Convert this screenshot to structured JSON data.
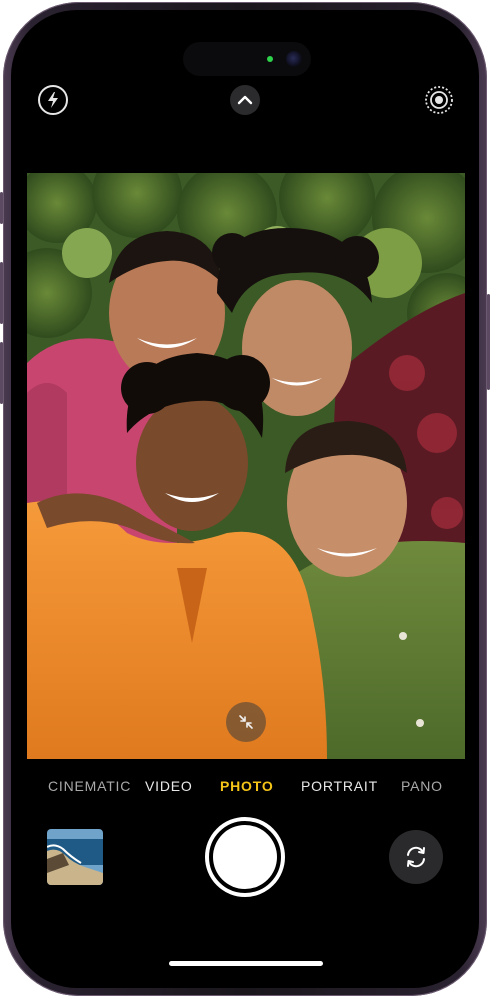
{
  "camera": {
    "modes": [
      {
        "label": "CINEMATIC",
        "state": "dim"
      },
      {
        "label": "VIDEO",
        "state": "normal"
      },
      {
        "label": "PHOTO",
        "state": "active"
      },
      {
        "label": "PORTRAIT",
        "state": "normal"
      },
      {
        "label": "PANO",
        "state": "dim"
      }
    ],
    "active_mode": "PHOTO",
    "icons": {
      "flash": "flash-icon",
      "controls": "chevron-up-icon",
      "live_photo": "live-photo-icon",
      "zoom": "collapse-arrows-icon",
      "flip": "camera-flip-icon"
    },
    "colors": {
      "active_mode": "#f5c518",
      "status_dot": "#2dd34a",
      "frame": "#2a2230"
    }
  }
}
